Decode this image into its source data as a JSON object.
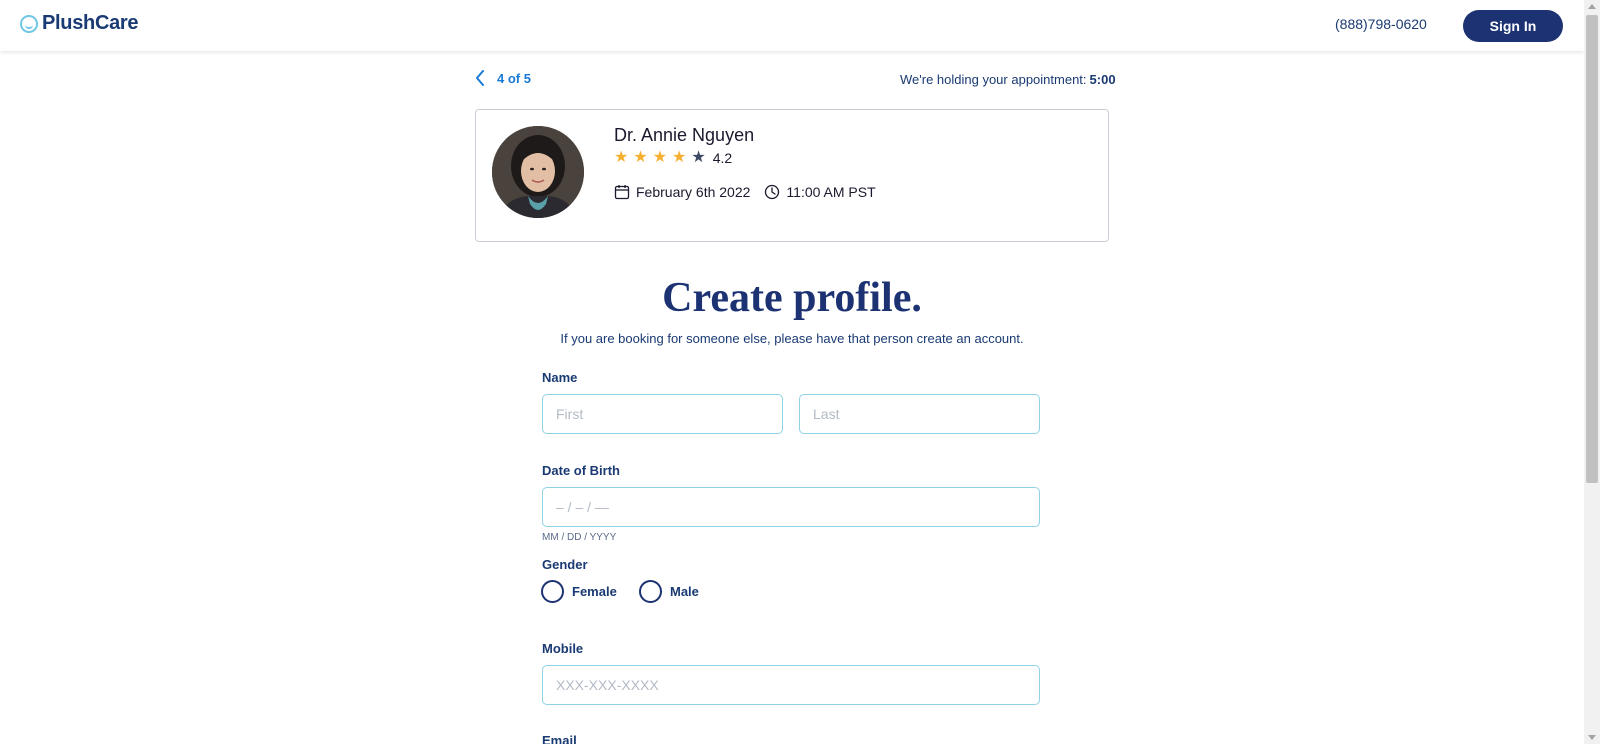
{
  "header": {
    "brand": "PlushCare",
    "phone": "(888)798-0620",
    "signin_label": "Sign In"
  },
  "progress": {
    "step": "4 of 5",
    "holding_text": "We're holding your appointment:",
    "holding_time": "5:00"
  },
  "doctor": {
    "name": "Dr. Annie Nguyen",
    "rating": "4.2",
    "stars_filled": 4,
    "stars_total": 5,
    "date": "February 6th 2022",
    "time": "11:00 AM PST"
  },
  "page": {
    "title": "Create profile.",
    "subtitle": "If you are booking for someone else, please have that person create an account."
  },
  "form": {
    "name_label": "Name",
    "first_placeholder": "First",
    "last_placeholder": "Last",
    "dob_label": "Date of Birth",
    "dob_placeholder": "– / – / —",
    "dob_hint": "MM / DD / YYYY",
    "gender_label": "Gender",
    "gender_female": "Female",
    "gender_male": "Male",
    "mobile_label": "Mobile",
    "mobile_placeholder": "XXX-XXX-XXXX",
    "email_label": "Email"
  },
  "colors": {
    "brand_navy": "#1d3272",
    "link_blue": "#1a7ad6",
    "star_gold": "#f5b031",
    "star_empty": "#3d4a63",
    "input_border": "#8fd2e8"
  }
}
